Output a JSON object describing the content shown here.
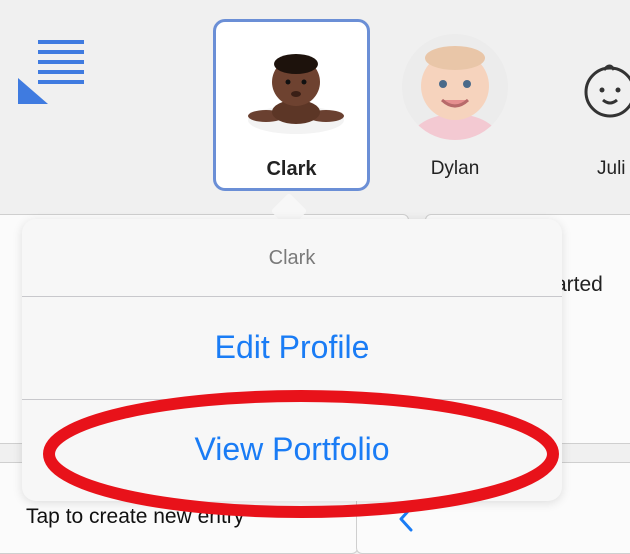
{
  "toolbar": {
    "menu_icon": "list-menu-icon"
  },
  "children": [
    {
      "name": "Clark",
      "selected": true,
      "photo_icon": "baby-photo-clark"
    },
    {
      "name": "Dylan",
      "selected": false,
      "photo_icon": "baby-photo-dylan"
    },
    {
      "name": "Juli",
      "selected": false,
      "photo_icon": "baby-face-placeholder-icon"
    }
  ],
  "background": {
    "right_card_text": "arted",
    "bottom_left_text": "Tap to create new entry",
    "bottom_right_icon": "chevron-left-icon"
  },
  "popover": {
    "title": "Clark",
    "items": [
      {
        "label": "Edit Profile"
      },
      {
        "label": "View Portfolio"
      }
    ]
  },
  "annotation": {
    "type": "red-ellipse-highlight",
    "target": "View Portfolio",
    "color": "#e8121a"
  },
  "colors": {
    "accent": "#1a7cf5",
    "tile_selected_border": "#6b8fd6",
    "menu_icon": "#3f7be0"
  }
}
